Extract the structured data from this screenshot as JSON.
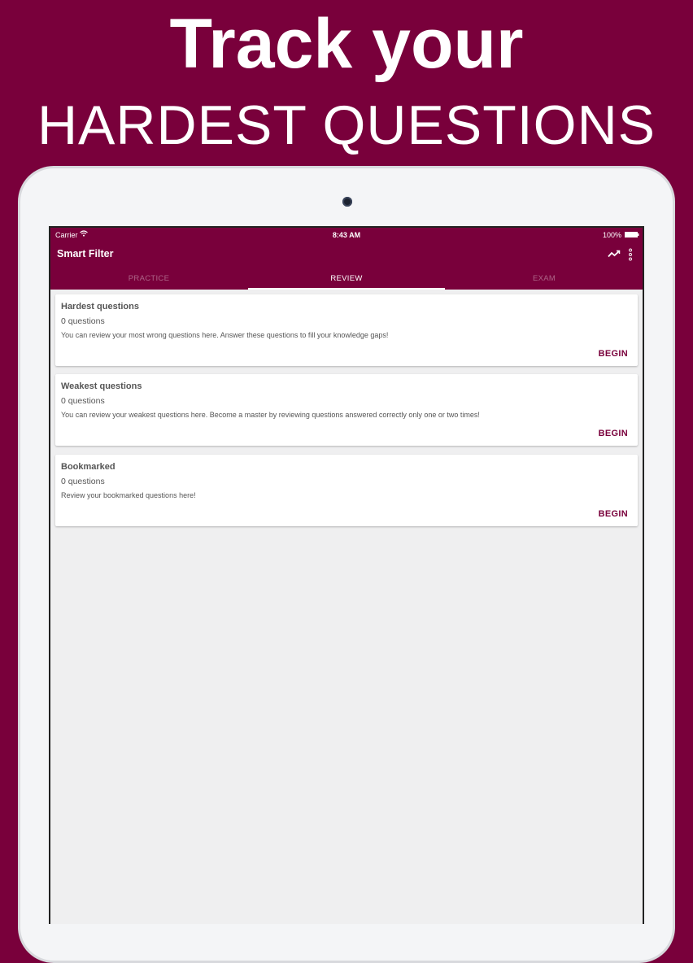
{
  "promo": {
    "headline_line1": "Track your",
    "headline_line2": "HARDEST QUESTIONS"
  },
  "status_bar": {
    "carrier": "Carrier",
    "time": "8:43 AM",
    "battery": "100%"
  },
  "app_bar": {
    "title": "Smart Filter",
    "icons": [
      "trending-up-icon",
      "more-vertical-icon"
    ]
  },
  "tabs": [
    {
      "label": "PRACTICE",
      "active": false
    },
    {
      "label": "REVIEW",
      "active": true
    },
    {
      "label": "EXAM",
      "active": false
    }
  ],
  "cards": [
    {
      "title": "Hardest questions",
      "count": "0 questions",
      "description": "You can review your most wrong questions here. Answer these questions to fill your knowledge gaps!",
      "action": "BEGIN"
    },
    {
      "title": "Weakest questions",
      "count": "0 questions",
      "description": "You can review your weakest questions here. Become a master by reviewing questions answered correctly only one or two times!",
      "action": "BEGIN"
    },
    {
      "title": "Bookmarked",
      "count": "0 questions",
      "description": "Review your bookmarked questions here!",
      "action": "BEGIN"
    }
  ],
  "colors": {
    "brand": "#79003b",
    "background": "#efeff0",
    "card": "#ffffff",
    "text": "#555555"
  }
}
